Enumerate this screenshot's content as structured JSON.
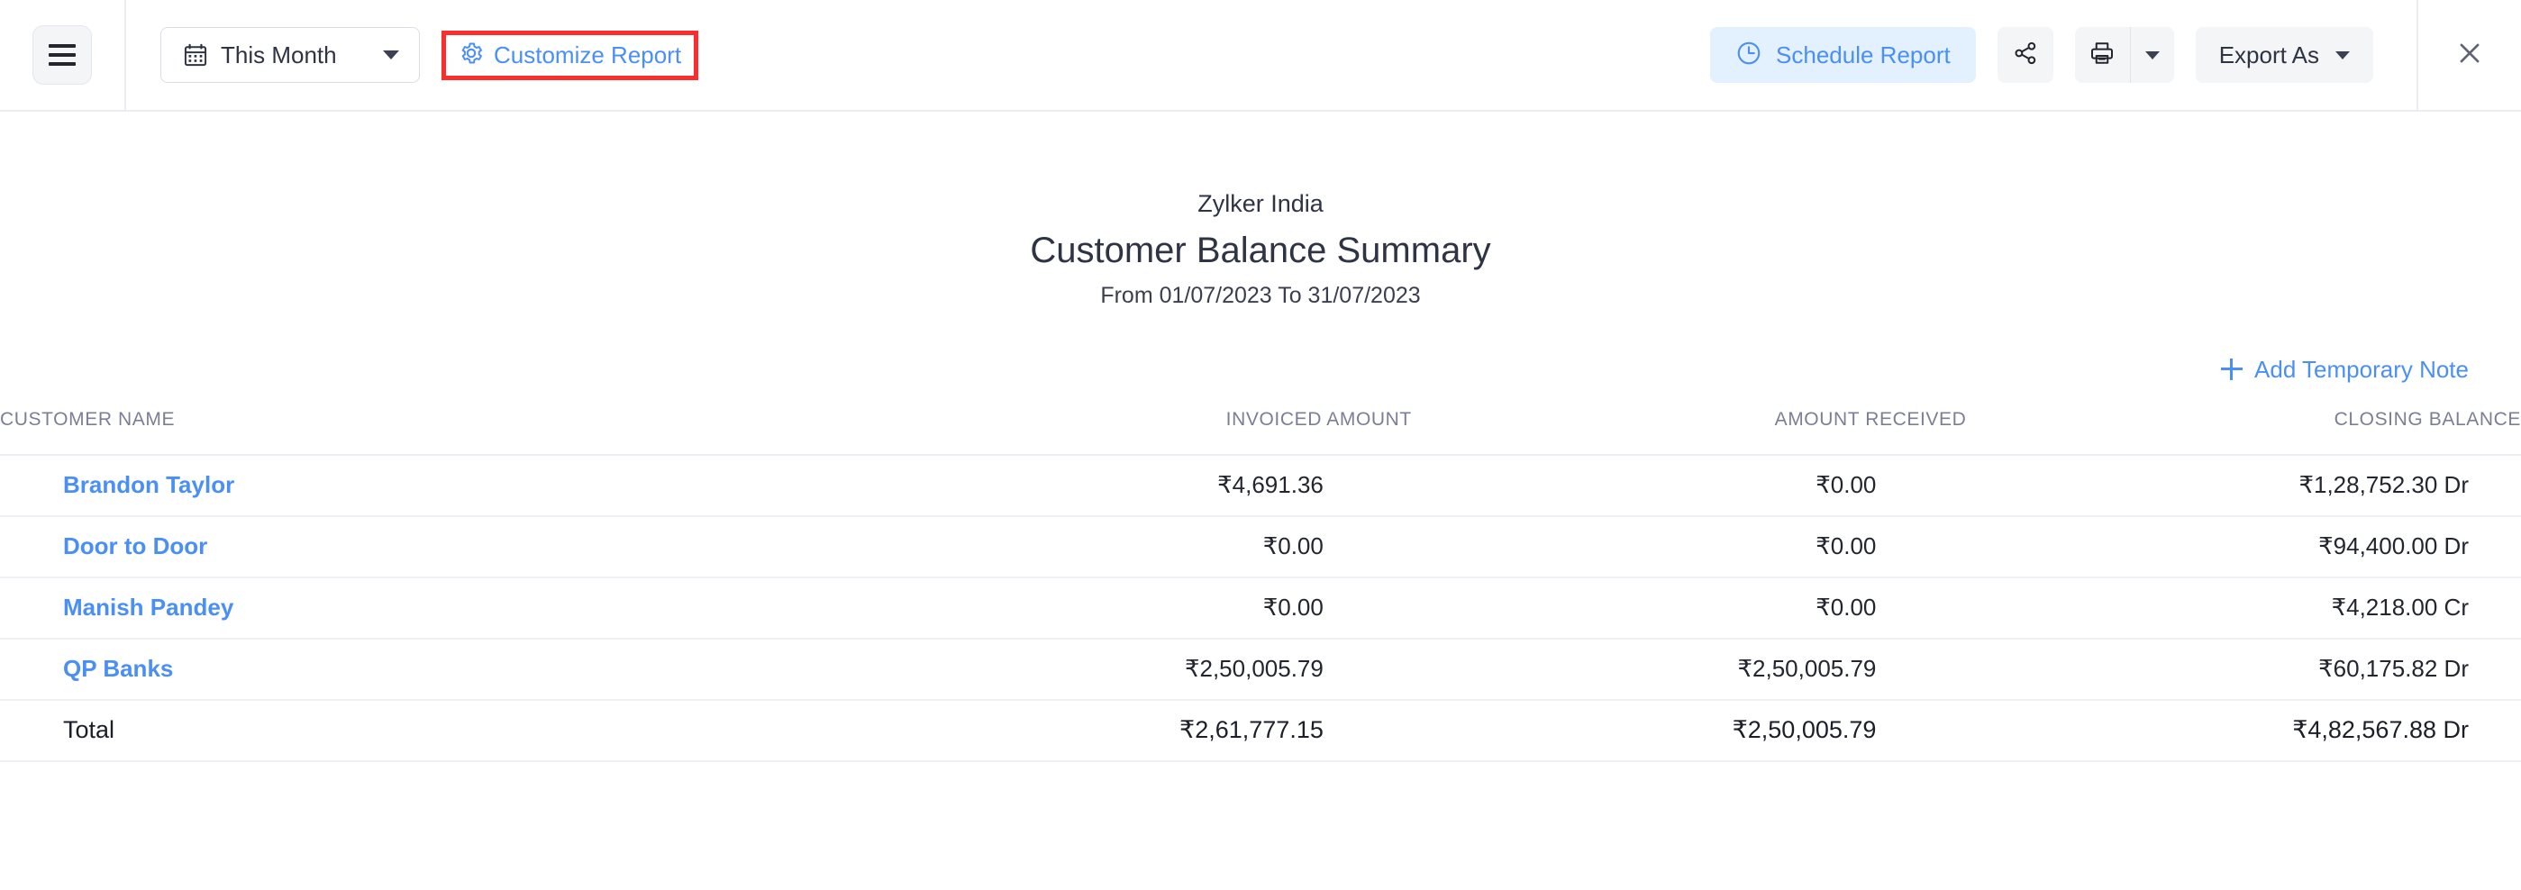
{
  "toolbar": {
    "menu_icon": "hamburger-icon",
    "date_filter": {
      "icon": "calendar-icon",
      "label": "This Month"
    },
    "customize": {
      "icon": "gear-icon",
      "label": "Customize Report",
      "highlight_color": "#fb2d2d"
    },
    "schedule": {
      "icon": "clock-icon",
      "label": "Schedule Report",
      "bg": "#e3f0fd",
      "fg": "#4a8ff7"
    },
    "share": {
      "icon": "share-icon"
    },
    "print": {
      "icon": "print-icon",
      "dropdown_icon": "chevron-down-icon"
    },
    "export": {
      "label": "Export As",
      "dropdown_icon": "chevron-down-icon"
    },
    "close": {
      "icon": "close-icon"
    }
  },
  "report": {
    "organization": "Zylker India",
    "title": "Customer Balance Summary",
    "date_range": "From 01/07/2023 To 31/07/2023",
    "add_note_label": "Add Temporary Note"
  },
  "table": {
    "columns": [
      "CUSTOMER NAME",
      "INVOICED AMOUNT",
      "AMOUNT RECEIVED",
      "CLOSING BALANCE"
    ],
    "rows": [
      {
        "customer_name": "Brandon Taylor",
        "invoiced_amount": "₹4,691.36",
        "amount_received": "₹0.00",
        "closing_balance": "₹1,28,752.30 Dr"
      },
      {
        "customer_name": "Door to Door",
        "invoiced_amount": "₹0.00",
        "amount_received": "₹0.00",
        "closing_balance": "₹94,400.00 Dr"
      },
      {
        "customer_name": "Manish Pandey",
        "invoiced_amount": "₹0.00",
        "amount_received": "₹0.00",
        "closing_balance": "₹4,218.00 Cr"
      },
      {
        "customer_name": "QP Banks",
        "invoiced_amount": "₹2,50,005.79",
        "amount_received": "₹2,50,005.79",
        "closing_balance": "₹60,175.82 Dr"
      }
    ],
    "total": {
      "customer_name": "Total",
      "invoiced_amount": "₹2,61,777.15",
      "amount_received": "₹2,50,005.79",
      "closing_balance": "₹4,82,567.88 Dr"
    }
  }
}
